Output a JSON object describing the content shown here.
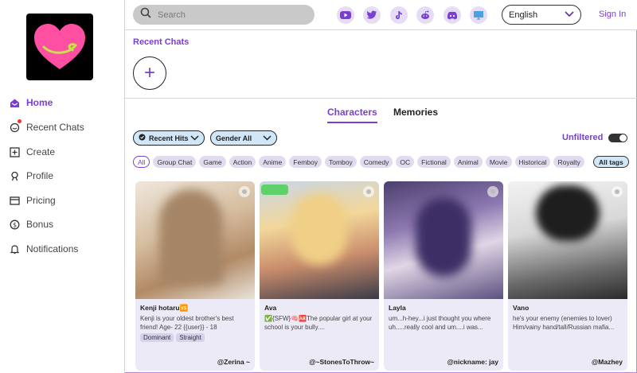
{
  "search": {
    "placeholder": "Search"
  },
  "language": {
    "selected": "English"
  },
  "auth": {
    "signin_label": "Sign In"
  },
  "nav": {
    "items": [
      {
        "label": "Home",
        "icon": "home-icon",
        "active": true
      },
      {
        "label": "Recent Chats",
        "icon": "chat-icon",
        "active": false
      },
      {
        "label": "Create",
        "icon": "plus-square-icon",
        "active": false
      },
      {
        "label": "Profile",
        "icon": "profile-icon",
        "active": false
      },
      {
        "label": "Pricing",
        "icon": "card-icon",
        "active": false
      },
      {
        "label": "Bonus",
        "icon": "coin-icon",
        "active": false
      },
      {
        "label": "Notifications",
        "icon": "bell-icon",
        "active": false
      }
    ]
  },
  "social": [
    "youtube-icon",
    "twitter-icon",
    "tiktok-icon",
    "reddit-icon",
    "discord-icon",
    "desktop-icon"
  ],
  "recent": {
    "title": "Recent Chats",
    "add_label": "+"
  },
  "tabs": [
    {
      "label": "Characters",
      "active": true
    },
    {
      "label": "Memories",
      "active": false
    }
  ],
  "filters": {
    "sort_label": "Recent Hits",
    "gender_label": "Gender All",
    "unfiltered_label": "Unfiltered",
    "all_tags_label": "All tags"
  },
  "tags": [
    "All",
    "Group Chat",
    "Game",
    "Action",
    "Anime",
    "Femboy",
    "Tomboy",
    "Comedy",
    "OC",
    "Fictional",
    "Animal",
    "Movie",
    "Historical",
    "Royalty"
  ],
  "cards": [
    {
      "name": "Kenji hotaru🆚",
      "desc": "Kenji is your oldest brother's best friend! Age- 22 {{user}} - 18",
      "tags": [
        "Dominant",
        "Straight"
      ],
      "author": "@Zerina ~"
    },
    {
      "name": "Ava",
      "desc": "✅{SFW}🧠🆎The popular girl at your school is your bully....",
      "tags": [],
      "author": "@~StonesToThrow~"
    },
    {
      "name": "Layla",
      "desc": "um...h-hey...i just thought you where uh.....really cool and um....i was...",
      "tags": [],
      "author": "@nickname: jay"
    },
    {
      "name": "Vano",
      "desc": "he's your enemy (enemies to lover) Him/vainy hand/tall/Russian mafia...",
      "tags": [],
      "author": "@Mazhey"
    }
  ],
  "colors": {
    "accent": "#7a3fd1",
    "chip": "#e2dbf0",
    "dropdown": "#cfe7f8",
    "logo_heart": "#ff4fa3"
  }
}
